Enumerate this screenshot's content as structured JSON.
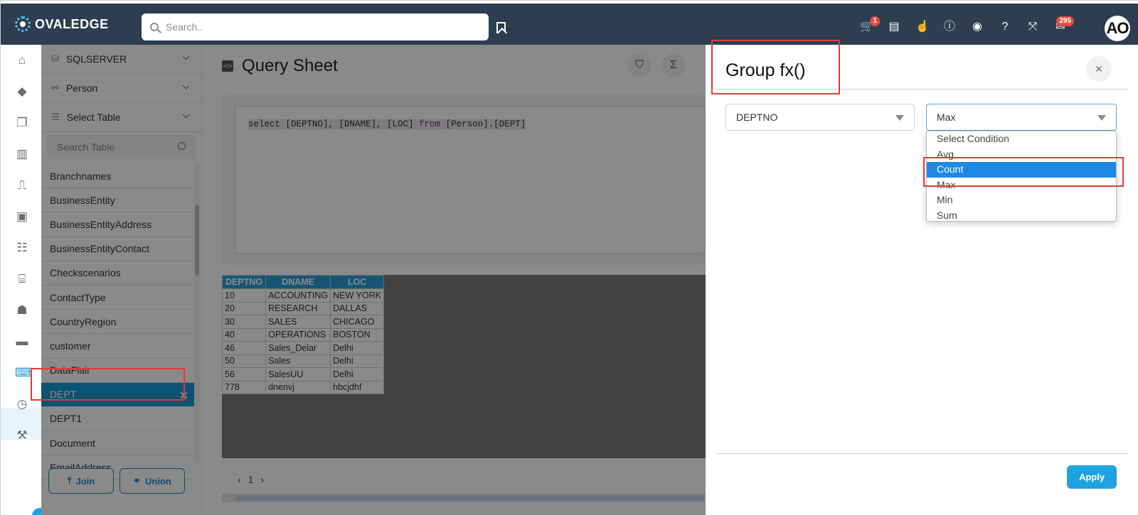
{
  "app": {
    "logo_text": "OVALEDGE"
  },
  "header": {
    "search_placeholder": "Search..",
    "cart_badge": "1",
    "mail_badge": "295",
    "avatar_initials": "AO"
  },
  "left_panel": {
    "connection": "SQLSERVER",
    "schema": "Person",
    "select_table": "Select Table",
    "search_placeholder": "Search Table",
    "tables": [
      "Branchnames",
      "BusinessEntity",
      "BusinessEntityAddress",
      "BusinessEntityContact",
      "Checkscenarios",
      "ContactType",
      "CountryRegion",
      "customer",
      "DataFlair",
      "DEPT",
      "DEPT1",
      "Document",
      "EmailAddress"
    ],
    "selected_table": "DEPT",
    "join_label": "Join",
    "union_label": "Union"
  },
  "main": {
    "title": "Query Sheet",
    "query": {
      "p1": "select [DEPTNO], [DNAME], [LOC] ",
      "kw": "from",
      "p2": " [Person].[DEPT]"
    },
    "results": {
      "headers": [
        "DEPTNO",
        "DNAME",
        "LOC"
      ],
      "rows": [
        [
          "10",
          "ACCOUNTING",
          "NEW YORK"
        ],
        [
          "20",
          "RESEARCH",
          "DALLAS"
        ],
        [
          "30",
          "SALES",
          "CHICAGO"
        ],
        [
          "40",
          "OPERATIONS",
          "BOSTON"
        ],
        [
          "46",
          "Sales_Delar",
          "Delhi"
        ],
        [
          "50",
          "Sales",
          "Delhi"
        ],
        [
          "56",
          "SalesUU",
          "Delhi"
        ],
        [
          "778",
          "dnenvj",
          "hbcjdhf"
        ]
      ]
    },
    "page": "1"
  },
  "drawer": {
    "title": "Group fx()",
    "column_value": "DEPTNO",
    "function_value": "Max",
    "options": [
      "Select Condition",
      "Avg",
      "Count",
      "Max",
      "Min",
      "Sum"
    ],
    "highlighted_option": "Count",
    "apply_label": "Apply"
  },
  "colors": {
    "topbar": "#2c3e50",
    "accent": "#1798d3",
    "highlight": "#1e88e5",
    "annotation": "#e53935"
  }
}
